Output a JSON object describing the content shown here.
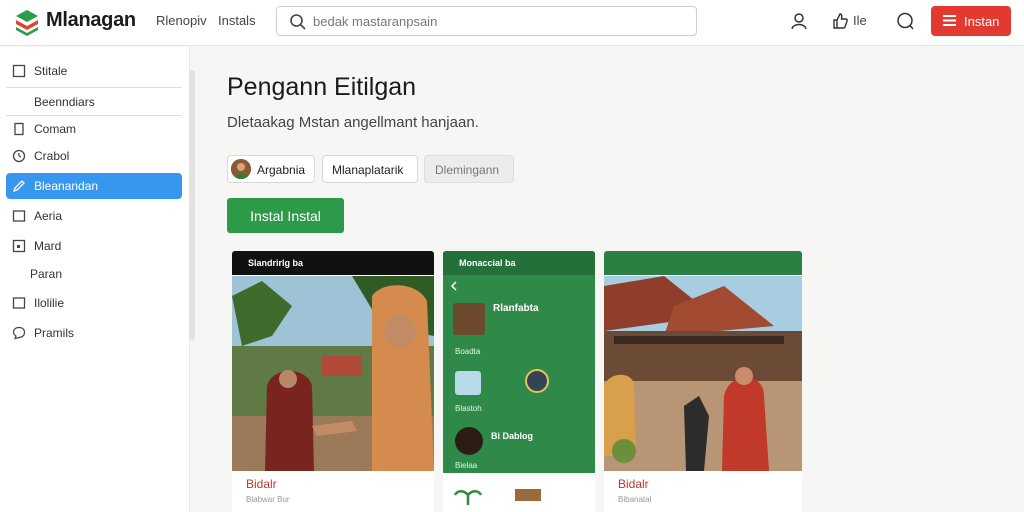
{
  "app": {
    "brand": "Mlanagan",
    "nav": [
      "Rlenopiv",
      "Instals"
    ],
    "search_placeholder": "bedak mastaranpsain",
    "topbar_label": "Ile",
    "install_label": "Instan"
  },
  "sidebar": {
    "items": [
      {
        "label": "Stitale",
        "icon": "square-icon"
      },
      {
        "label": "Beenndiars",
        "icon": ""
      },
      {
        "label": "Comam",
        "icon": "bookmark-icon"
      },
      {
        "label": "Crabol",
        "icon": "clock-icon"
      },
      {
        "label": "Bleanandan",
        "icon": "pen-icon",
        "active": true
      },
      {
        "label": "Aeria",
        "icon": "square-icon"
      },
      {
        "label": "Mard",
        "icon": "square-icon"
      },
      {
        "label": "Paran",
        "icon": ""
      },
      {
        "label": "Ilolilie",
        "icon": "square-icon"
      },
      {
        "label": "Pramils",
        "icon": "chat-icon"
      }
    ]
  },
  "main": {
    "title": "Pengann Eitilgan",
    "subtitle": "Dletaakag Mstan angellmant hanjaan.",
    "chips": [
      "Argabnia",
      "Mlanaplatarik",
      "Dlemingann"
    ],
    "install_button": "Instal Instal"
  },
  "screenshots": [
    {
      "status": "Slandrirlg ba",
      "title": "Bidalr",
      "sub": "Blabwar Bur"
    },
    {
      "status": "Monaccial ba",
      "header": "Rlanfabta",
      "rows": [
        "Boadta",
        "Blastoh",
        "Bi Dablog",
        "Bielaa"
      ],
      "title": "",
      "sub": ""
    },
    {
      "status": "",
      "title": "Bidalr",
      "sub": "Bibanatal"
    }
  ],
  "colors": {
    "accent_red": "#e23a31",
    "accent_green": "#2c9a48",
    "active_blue": "#3797ee",
    "phone_green": "#2f8a4a"
  }
}
